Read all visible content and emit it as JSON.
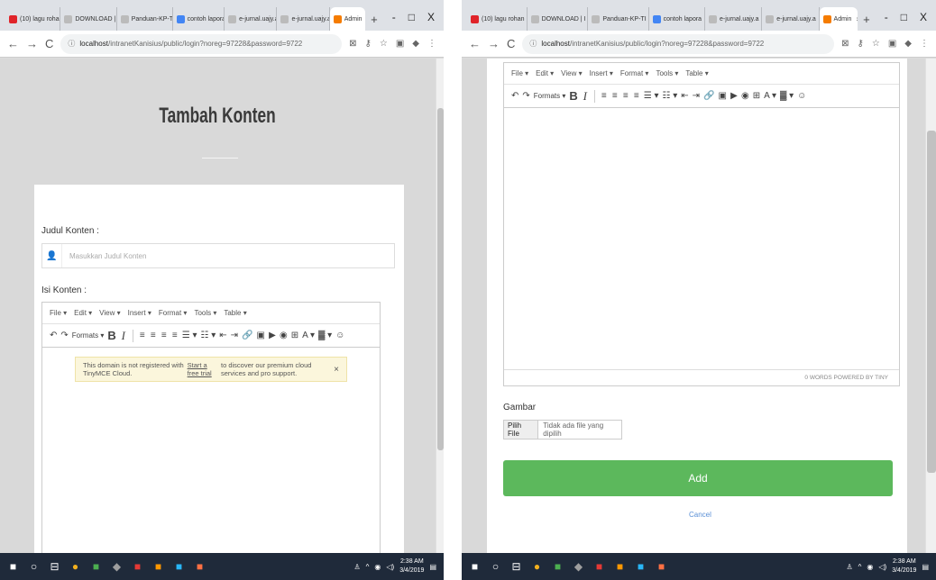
{
  "browser": {
    "tabs": [
      {
        "label": "(10) lagu rohan",
        "color": "#e0242a"
      },
      {
        "label": "DOWNLOAD | I",
        "color": "#bbbbbb"
      },
      {
        "label": "Panduan-KP-TI",
        "color": "#bbbbbb"
      },
      {
        "label": "contoh lapora",
        "color": "#4285f4"
      },
      {
        "label": "e-jurnal.uajy.a",
        "color": "#bbbbbb"
      },
      {
        "label": "e-jurnal.uajy.a",
        "color": "#bbbbbb"
      },
      {
        "label": "Admin",
        "color": "#f57c00"
      }
    ],
    "new_tab": "+",
    "window_controls": [
      "-",
      "□",
      "X"
    ],
    "url_host": "localhost",
    "url_path": "/intranetKanisius/public/login?noreg=97228&password=9722",
    "nav": [
      "←",
      "→",
      "C"
    ]
  },
  "left": {
    "page_title": "Tambah Konten",
    "judul_label": "Judul Konten :",
    "judul_placeholder": "Masukkan Judul Konten",
    "isi_label": "Isi Konten :",
    "notice_text_before": "This domain is not registered with TinyMCE Cloud.",
    "notice_link": "Start a free trial",
    "notice_text_after": "to discover our premium cloud services and pro support.",
    "notice_close": "×"
  },
  "editor": {
    "menus": [
      "File ▾",
      "Edit ▾",
      "View ▾",
      "Insert ▾",
      "Format ▾",
      "Tools ▾",
      "Table ▾"
    ],
    "toolbar": {
      "undo": "↶",
      "redo": "↷",
      "formats": "Formats ▾",
      "bold": "B",
      "italic": "I",
      "align_left": "≡",
      "align_center": "≡",
      "align_right": "≡",
      "justify": "≡",
      "bullist": "☰ ▾",
      "numlist": "☷ ▾",
      "outdent": "⇤",
      "indent": "⇥",
      "link": "🔗",
      "image": "▣",
      "media": "▶",
      "preview": "◉",
      "table": "⊞",
      "forecolor": "A ▾",
      "backcolor": "▓ ▾",
      "emoticons": "☺"
    },
    "status": "0 WORDS POWERED BY TINY"
  },
  "right": {
    "gambar_label": "Gambar",
    "file_button": "Pilih File",
    "file_status": "Tidak ada file yang dipilih",
    "add_button": "Add",
    "cancel_link": "Cancel"
  },
  "taskbar": {
    "icons": [
      {
        "name": "windows",
        "glyph": "■",
        "color": "#ffffff"
      },
      {
        "name": "search",
        "glyph": "○",
        "color": "#ffffff"
      },
      {
        "name": "task-view",
        "glyph": "⊟",
        "color": "#ffffff"
      },
      {
        "name": "chrome",
        "glyph": "●",
        "color": "#f2b01e"
      },
      {
        "name": "files",
        "glyph": "■",
        "color": "#4caf50"
      },
      {
        "name": "app",
        "glyph": "◆",
        "color": "#9e9e9e"
      },
      {
        "name": "app-red",
        "glyph": "■",
        "color": "#e53935"
      },
      {
        "name": "app-orange",
        "glyph": "■",
        "color": "#ff9800"
      },
      {
        "name": "app-blue",
        "glyph": "■",
        "color": "#29b6f6"
      },
      {
        "name": "app-orange2",
        "glyph": "■",
        "color": "#ff7043"
      }
    ],
    "time_left": "2:38 AM",
    "date_left": "3/4/2019",
    "time_right": "2:38 AM",
    "date_right": "3/4/2019"
  }
}
